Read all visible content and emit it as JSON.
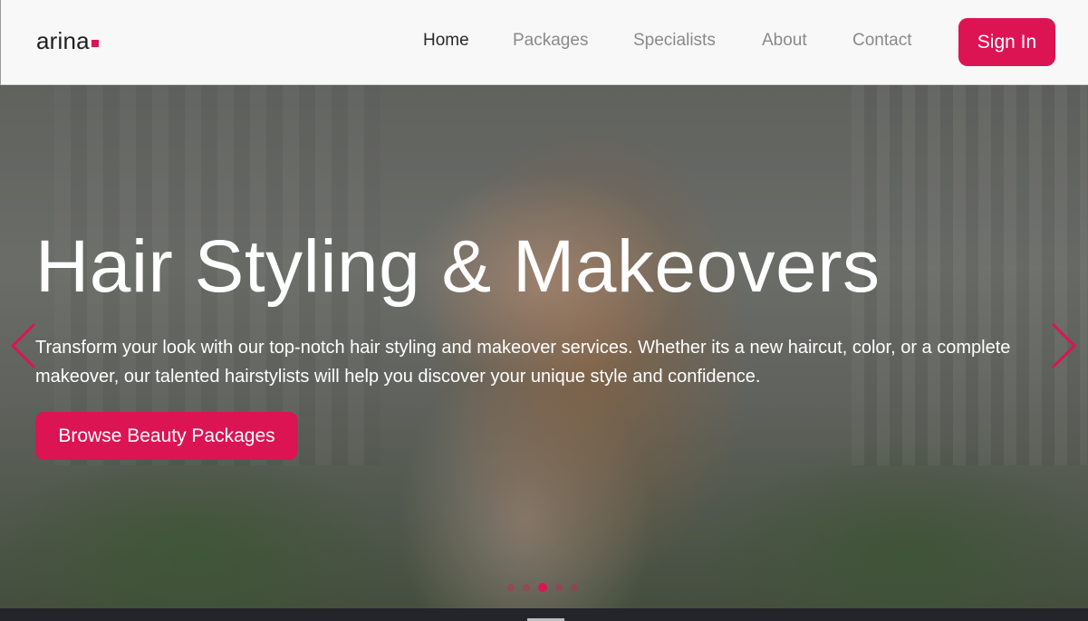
{
  "brand": {
    "name": "arina"
  },
  "nav": {
    "items": [
      {
        "label": "Home",
        "active": true
      },
      {
        "label": "Packages",
        "active": false
      },
      {
        "label": "Specialists",
        "active": false
      },
      {
        "label": "About",
        "active": false
      },
      {
        "label": "Contact",
        "active": false
      }
    ],
    "signin_label": "Sign In"
  },
  "hero": {
    "title": "Hair Styling & Makeovers",
    "text": "Transform your look with our top-notch hair styling and makeover services. Whether its a new haircut, color, or a complete makeover, our talented hairstylists will help you discover your unique style and confidence.",
    "cta_label": "Browse Beauty Packages",
    "slides_count": 5,
    "active_slide": 3
  },
  "colors": {
    "accent": "#dc1453",
    "nav_bg": "#f8f8f8",
    "text_light": "#ffffff"
  },
  "icons": {
    "prev": "chevron-left-icon",
    "next": "chevron-right-icon"
  }
}
